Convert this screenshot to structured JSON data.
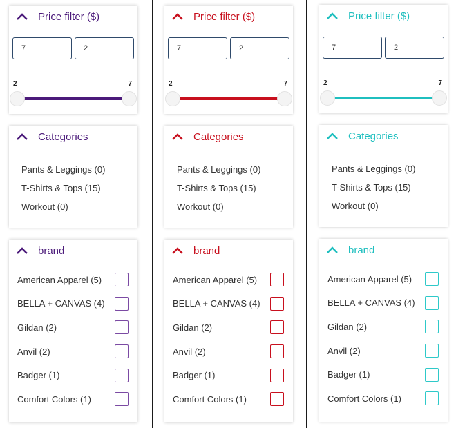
{
  "variants": [
    {
      "name": "purple",
      "accent": "#4b1a7a",
      "checkbox_color": "#7b4aa3",
      "price_filter": {
        "title": "Price filter ($)",
        "min_input_value": "7",
        "max_input_value": "2",
        "slider_min_label": "2",
        "slider_max_label": "7",
        "range_low": 2,
        "range_high": 7
      },
      "categories": {
        "title": "Categories",
        "items": [
          "Pants & Leggings (0)",
          "T-Shirts & Tops (15)",
          "Workout (0)"
        ]
      },
      "brand": {
        "title": "brand",
        "items": [
          "American Apparel (5)",
          "BELLA + CANVAS (4)",
          "Gildan (2)",
          "Anvil (2)",
          "Badger (1)",
          "Comfort Colors (1)"
        ]
      }
    },
    {
      "name": "red",
      "accent": "#c8101e",
      "checkbox_color": "#c8101e",
      "price_filter": {
        "title": "Price filter ($)",
        "min_input_value": "7",
        "max_input_value": "2",
        "slider_min_label": "2",
        "slider_max_label": "7",
        "range_low": 2,
        "range_high": 7
      },
      "categories": {
        "title": "Categories",
        "items": [
          "Pants & Leggings (0)",
          "T-Shirts & Tops (15)",
          "Workout (0)"
        ]
      },
      "brand": {
        "title": "brand",
        "items": [
          "American Apparel (5)",
          "BELLA + CANVAS (4)",
          "Gildan (2)",
          "Anvil (2)",
          "Badger (1)",
          "Comfort Colors (1)"
        ]
      }
    },
    {
      "name": "teal",
      "accent": "#1fbfbf",
      "checkbox_color": "#2ec9c9",
      "price_filter": {
        "title": "Price filter ($)",
        "min_input_value": "7",
        "max_input_value": "2",
        "slider_min_label": "2",
        "slider_max_label": "7",
        "range_low": 2,
        "range_high": 7
      },
      "categories": {
        "title": "Categories",
        "items": [
          "Pants & Leggings (0)",
          "T-Shirts & Tops (15)",
          "Workout (0)"
        ]
      },
      "brand": {
        "title": "brand",
        "items": [
          "American Apparel (5)",
          "BELLA + CANVAS (4)",
          "Gildan (2)",
          "Anvil (2)",
          "Badger (1)",
          "Comfort Colors (1)"
        ]
      }
    }
  ]
}
